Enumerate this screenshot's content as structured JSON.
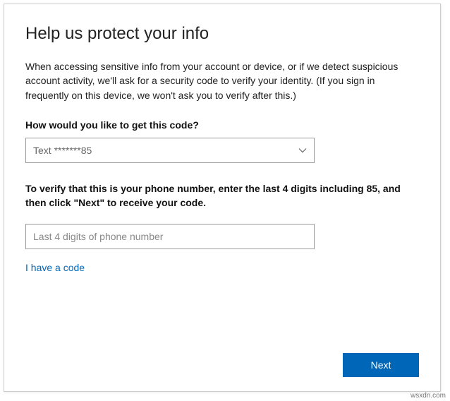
{
  "heading": "Help us protect your info",
  "body_text": "When accessing sensitive info from your account or device, or if we detect suspicious account activity, we'll ask for a security code to verify your identity. (If you sign in frequently on this device, we won't ask you to verify after this.)",
  "method_prompt": "How would you like to get this code?",
  "method_dropdown": {
    "selected_value": "Text *******85"
  },
  "verify_instruction": "To verify that this is your phone number, enter the last 4 digits including 85, and then click \"Next\" to receive your code.",
  "digits_input": {
    "placeholder": "Last 4 digits of phone number",
    "value": ""
  },
  "have_code_link": "I have a code",
  "next_button_label": "Next",
  "attribution": "wsxdn.com"
}
